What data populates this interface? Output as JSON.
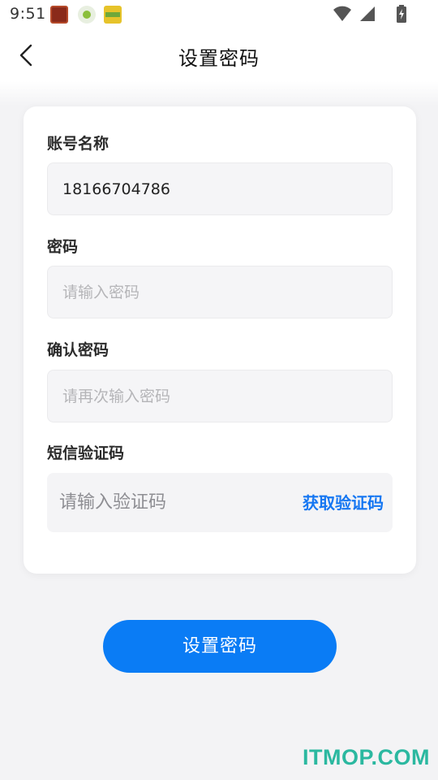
{
  "status_bar": {
    "time": "9:51",
    "notification_icons": [
      "app-notification-icon-1",
      "app-notification-icon-2",
      "app-notification-icon-3"
    ],
    "system_icons": [
      "wifi-icon",
      "signal-icon",
      "battery-charging-icon"
    ]
  },
  "header": {
    "title": "设置密码",
    "back_icon": "chevron-left-icon"
  },
  "form": {
    "account": {
      "label": "账号名称",
      "value": "18166704786"
    },
    "password": {
      "label": "密码",
      "placeholder": "请输入密码"
    },
    "confirm_password": {
      "label": "确认密码",
      "placeholder": "请再次输入密码"
    },
    "sms_code": {
      "label": "短信验证码",
      "placeholder": "请输入验证码",
      "get_code_label": "获取验证码"
    }
  },
  "submit_label": "设置密码",
  "watermark": "ITMOP.COM",
  "colors": {
    "accent": "#0a7cf5",
    "link": "#1677f2",
    "background": "#f3f3f5",
    "watermark": "#2bb8a0"
  }
}
